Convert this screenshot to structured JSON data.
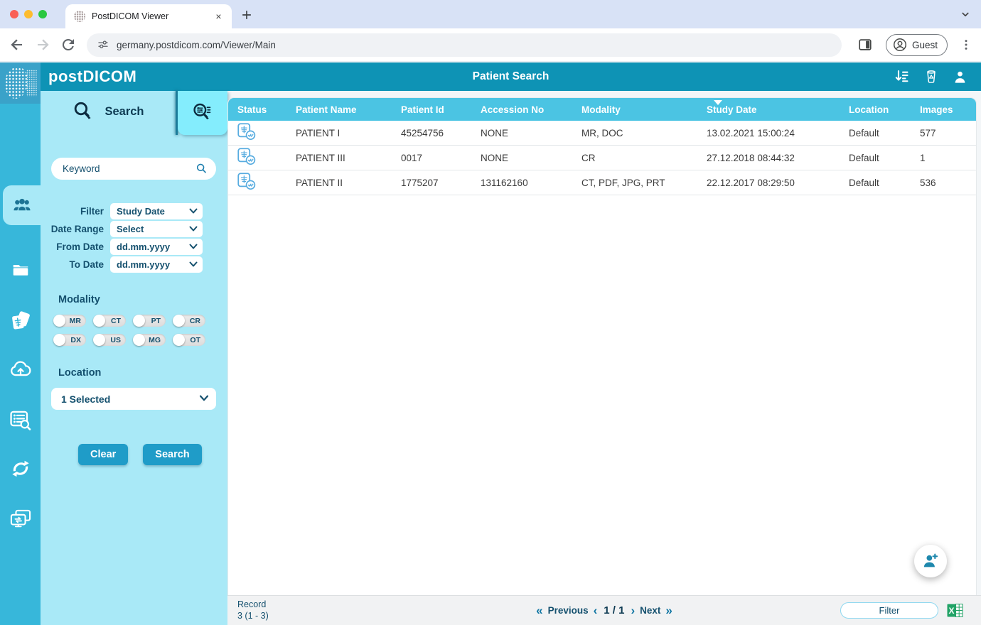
{
  "browser": {
    "tab_title": "PostDICOM Viewer",
    "url": "germany.postdicom.com/Viewer/Main",
    "profile_label": "Guest",
    "close_glyph": "×"
  },
  "header": {
    "logo_text": "postDICOM",
    "title": "Patient Search",
    "icons": [
      "sort-list-icon",
      "trash-recycle-icon",
      "user-icon"
    ]
  },
  "rail": {
    "items": [
      "patients",
      "folders",
      "studies",
      "cloud-upload",
      "order-search",
      "sync",
      "share-screen"
    ],
    "active_item": "patients"
  },
  "search_panel": {
    "search_tab_label": "Search",
    "keyword_placeholder": "Keyword",
    "form": [
      {
        "label": "Filter",
        "value": "Study Date"
      },
      {
        "label": "Date Range",
        "value": "Select"
      },
      {
        "label": "From Date",
        "value": "dd.mm.yyyy"
      },
      {
        "label": "To Date",
        "value": "dd.mm.yyyy"
      }
    ],
    "modality_label": "Modality",
    "modalities": [
      "MR",
      "CT",
      "PT",
      "CR",
      "DX",
      "US",
      "MG",
      "OT"
    ],
    "location_label": "Location",
    "location_value": "1 Selected",
    "clear_label": "Clear",
    "search_label": "Search"
  },
  "table": {
    "columns": [
      "Status",
      "Patient Name",
      "Patient Id",
      "Accession No",
      "Modality",
      "Study Date",
      "Location",
      "Images"
    ],
    "sorted_column": "Study Date",
    "sort_direction": "desc",
    "rows": [
      {
        "patient_name": "PATIENT I",
        "patient_id": "45254756",
        "accession_no": "NONE",
        "modality": "MR, DOC",
        "study_date": "13.02.2021 15:00:24",
        "location": "Default",
        "images": "577"
      },
      {
        "patient_name": "PATIENT III",
        "patient_id": "0017",
        "accession_no": "NONE",
        "modality": "CR",
        "study_date": "27.12.2018 08:44:32",
        "location": "Default",
        "images": "1"
      },
      {
        "patient_name": "PATIENT II",
        "patient_id": "1775207",
        "accession_no": "131162160",
        "modality": "CT, PDF, JPG, PRT",
        "study_date": "22.12.2017 08:29:50",
        "location": "Default",
        "images": "536"
      }
    ]
  },
  "footer": {
    "record_label": "Record",
    "record_count": "3 (1 - 3)",
    "prev_double": "«",
    "prev_single": "‹",
    "previous_label": "Previous",
    "page_info": "1 / 1",
    "next_single": "›",
    "next_label": "Next",
    "next_double": "»",
    "filter_label": "Filter"
  },
  "colors": {
    "header_teal": "#0E93B5",
    "rail_teal": "#37B7DA",
    "panel_cyan": "#A9E9F7",
    "adv_tab_cyan": "#84EDFD",
    "table_header_blue": "#4BC4E3",
    "button_blue": "#1F9CC8",
    "dark_navy_text": "#14506E",
    "status_icon_blue": "#57ACE0",
    "excel_green": "#21A366"
  }
}
